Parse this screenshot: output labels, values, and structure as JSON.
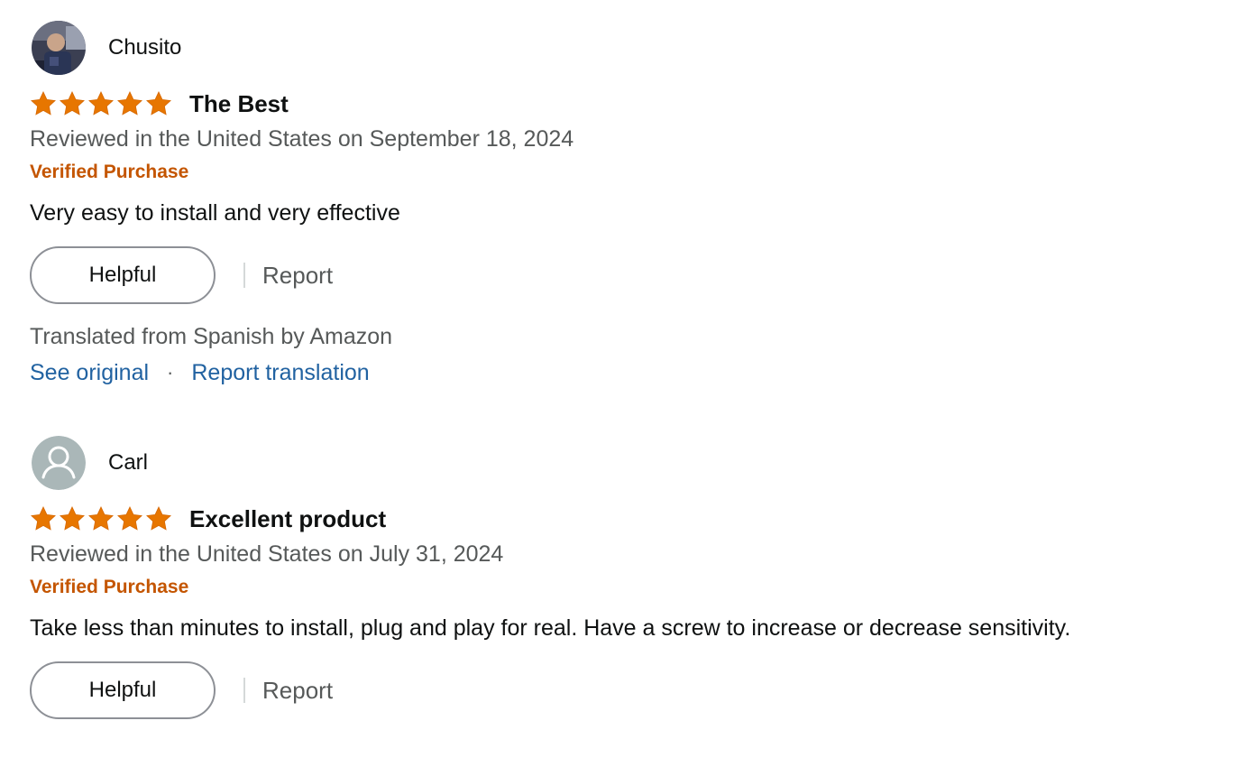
{
  "reviews": [
    {
      "reviewer": "Chusito",
      "avatar": "photo-avatar",
      "rating": 5,
      "title": "The Best",
      "date_line": "Reviewed in the United States on September 18, 2024",
      "badge": "Verified Purchase",
      "body": "Very easy to install and very effective",
      "helpful_label": "Helpful",
      "report_label": "Report",
      "translation_note": "Translated from Spanish by Amazon",
      "see_original_label": "See original",
      "separator": "·",
      "report_translation_label": "Report translation"
    },
    {
      "reviewer": "Carl",
      "avatar": "default-user-icon",
      "rating": 5,
      "title": "Excellent product",
      "date_line": "Reviewed in the United States on July 31, 2024",
      "badge": "Verified Purchase",
      "body": "Take less than minutes to install, plug and play for real. Have a screw to increase or decrease sensitivity.",
      "helpful_label": "Helpful",
      "report_label": "Report"
    }
  ],
  "colors": {
    "star": "#e77600",
    "badge": "#c45500",
    "link": "#2162a1",
    "muted_text": "#565959"
  }
}
